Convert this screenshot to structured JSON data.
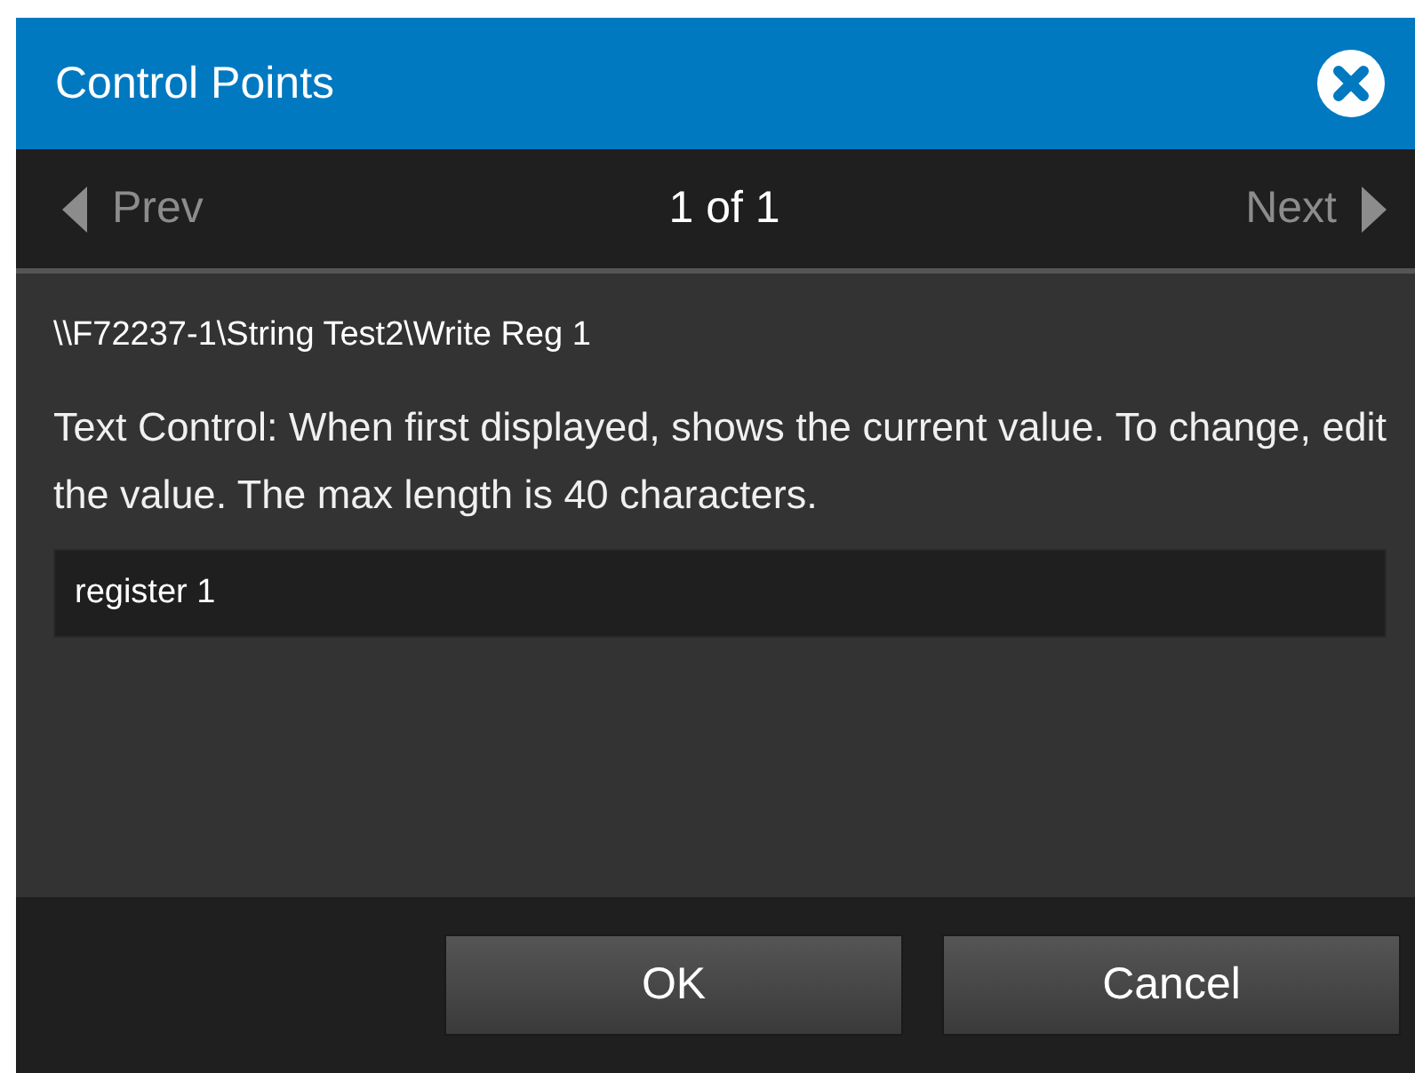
{
  "dialog": {
    "title": "Control Points"
  },
  "pager": {
    "prev": {
      "label": "Prev",
      "disabled": true
    },
    "position": "1 of 1",
    "next": {
      "label": "Next",
      "disabled": true
    }
  },
  "point": {
    "path": "\\\\F72237-1\\String Test2\\Write Reg 1",
    "description": "Text Control: When first displayed, shows the current value. To change, edit the value. The max length is 40 characters.",
    "value": "register 1"
  },
  "buttons": [
    {
      "label": "OK"
    },
    {
      "label": "Cancel"
    }
  ]
}
